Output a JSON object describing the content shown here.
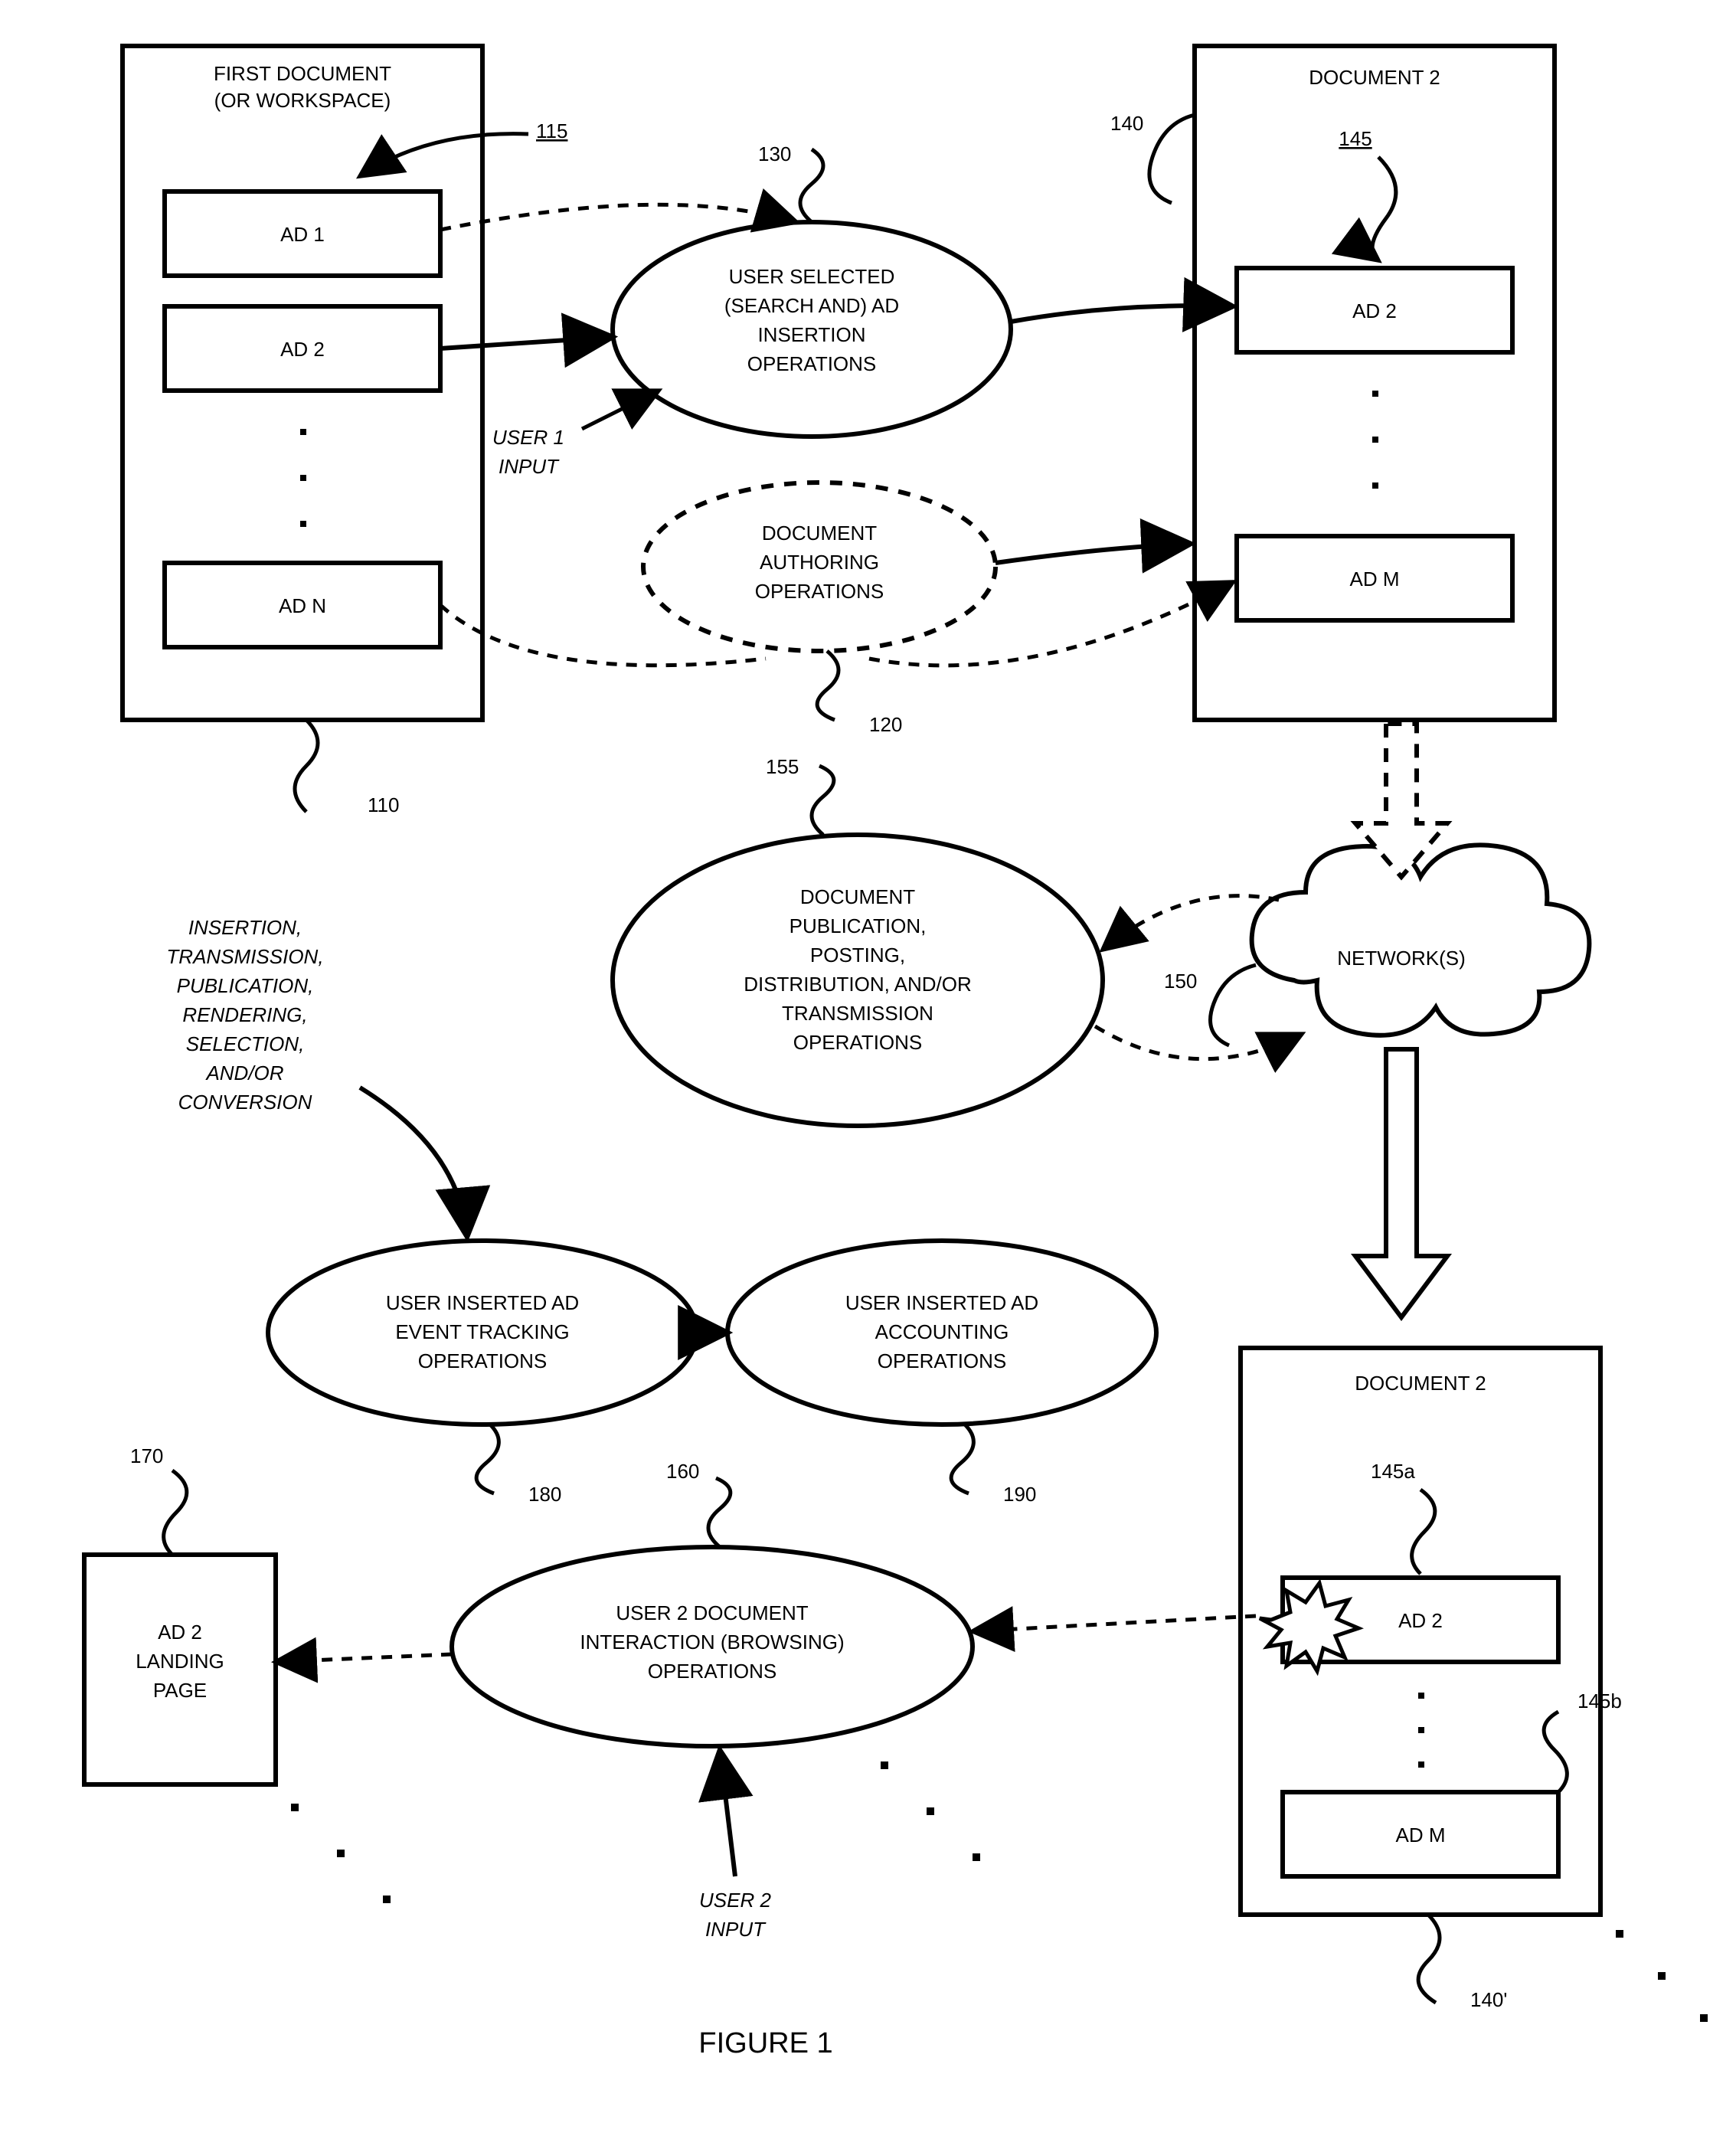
{
  "figure_title": "FIGURE 1",
  "boxes": {
    "first_doc": {
      "title1": "FIRST DOCUMENT",
      "title2": "(OR WORKSPACE)",
      "ad1": "AD 1",
      "ad2": "AD 2",
      "adn": "AD N"
    },
    "doc2_top": {
      "title": "DOCUMENT 2",
      "ad2": "AD 2",
      "adm": "AD M"
    },
    "doc2_bottom": {
      "title": "DOCUMENT 2",
      "ad2": "AD 2",
      "adm": "AD M"
    },
    "landing": {
      "l1": "AD 2",
      "l2": "LANDING",
      "l3": "PAGE"
    }
  },
  "ovals": {
    "insertion": {
      "l1": "USER SELECTED",
      "l2": "(SEARCH AND) AD",
      "l3": "INSERTION",
      "l4": "OPERATIONS"
    },
    "authoring": {
      "l1": "DOCUMENT",
      "l2": "AUTHORING",
      "l3": "OPERATIONS"
    },
    "publication": {
      "l1": "DOCUMENT",
      "l2": "PUBLICATION,",
      "l3": "POSTING,",
      "l4": "DISTRIBUTION, AND/OR",
      "l5": "TRANSMISSION",
      "l6": "OPERATIONS"
    },
    "tracking": {
      "l1": "USER INSERTED AD",
      "l2": "EVENT TRACKING",
      "l3": "OPERATIONS"
    },
    "accounting": {
      "l1": "USER INSERTED AD",
      "l2": "ACCOUNTING",
      "l3": "OPERATIONS"
    },
    "browsing": {
      "l1": "USER 2 DOCUMENT",
      "l2": "INTERACTION (BROWSING)",
      "l3": "OPERATIONS"
    },
    "network": "NETWORK(S)"
  },
  "labels": {
    "user1": {
      "l1": "USER 1",
      "l2": "INPUT"
    },
    "user2": {
      "l1": "USER 2",
      "l2": "INPUT"
    },
    "events": {
      "l1": "INSERTION,",
      "l2": "TRANSMISSION,",
      "l3": "PUBLICATION,",
      "l4": "RENDERING,",
      "l5": "SELECTION,",
      "l6": "AND/OR",
      "l7": "CONVERSION"
    }
  },
  "refs": {
    "r110": "110",
    "r115": "115",
    "r120": "120",
    "r130": "130",
    "r140": "140",
    "r140p": "140'",
    "r145": "145",
    "r145a": "145a",
    "r145b": "145b",
    "r150": "150",
    "r155": "155",
    "r160": "160",
    "r170": "170",
    "r180": "180",
    "r190": "190"
  }
}
